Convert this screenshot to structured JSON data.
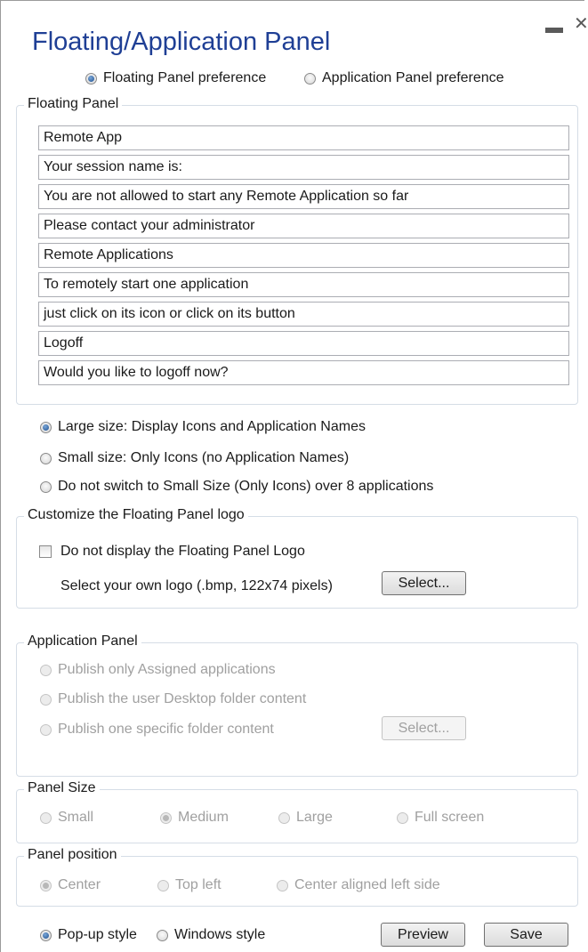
{
  "window": {
    "title": "Floating/Application Panel"
  },
  "preference": {
    "floating_label": "Floating Panel preference",
    "application_label": "Application Panel preference",
    "selected": "floating"
  },
  "floating_panel": {
    "legend": "Floating Panel",
    "fields": [
      "Remote App",
      "Your session name is:",
      "You are not allowed to start any Remote Application so far",
      "Please contact your administrator",
      "Remote Applications",
      "To remotely start one application",
      "just click on its icon or click on its button",
      "Logoff",
      "Would you like to logoff now?"
    ]
  },
  "size_options": {
    "large": "Large size: Display Icons and Application Names",
    "small": "Small size: Only Icons (no Application Names)",
    "no_switch": "Do not switch to Small Size (Only Icons) over 8 applications",
    "selected": "large"
  },
  "logo": {
    "legend": "Customize the Floating Panel logo",
    "checkbox_label": "Do not display the Floating Panel Logo",
    "checked": false,
    "select_hint": "Select your own logo (.bmp, 122x74 pixels)",
    "select_button": "Select..."
  },
  "application_panel": {
    "legend": "Application Panel",
    "assigned": "Publish only Assigned applications",
    "desktop": "Publish the user Desktop folder content",
    "specific": "Publish one specific folder content",
    "select_button": "Select..."
  },
  "panel_size": {
    "legend": "Panel Size",
    "small": "Small",
    "medium": "Medium",
    "large": "Large",
    "full": "Full screen",
    "selected": "medium"
  },
  "panel_position": {
    "legend": "Panel position",
    "center": "Center",
    "top_left": "Top left",
    "center_left": "Center aligned left side",
    "selected": "center"
  },
  "style": {
    "popup": "Pop-up style",
    "windows": "Windows style",
    "selected": "popup"
  },
  "buttons": {
    "preview": "Preview",
    "save": "Save"
  },
  "icons": {
    "minimize": "minimize-icon",
    "close": "close-icon"
  }
}
